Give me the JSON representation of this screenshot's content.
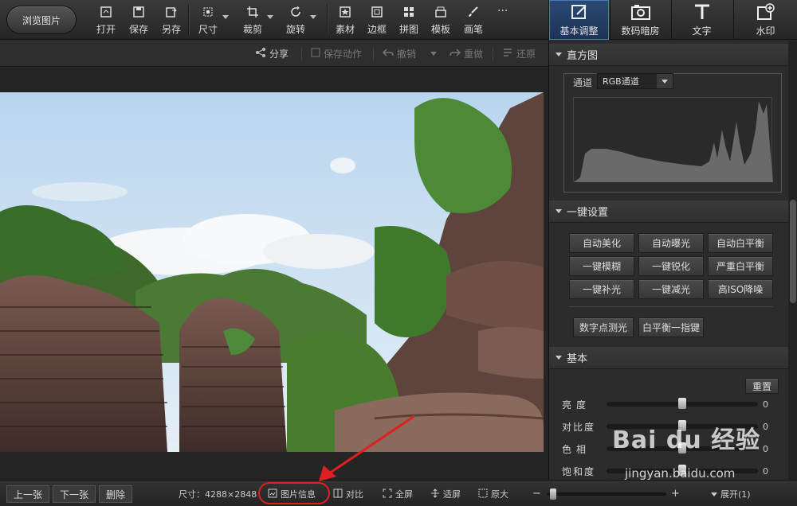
{
  "topbar": {
    "browse_label": "浏览图片",
    "tools": [
      {
        "label": "打开",
        "icon": "open-icon"
      },
      {
        "label": "保存",
        "icon": "save-icon"
      },
      {
        "label": "另存",
        "icon": "save-as-icon"
      },
      {
        "label": "尺寸",
        "icon": "resize-icon"
      },
      {
        "label": "裁剪",
        "icon": "crop-icon"
      },
      {
        "label": "旋转",
        "icon": "rotate-icon"
      },
      {
        "label": "素材",
        "icon": "material-icon"
      },
      {
        "label": "边框",
        "icon": "border-icon"
      },
      {
        "label": "拼图",
        "icon": "collage-icon"
      },
      {
        "label": "模板",
        "icon": "template-icon"
      },
      {
        "label": "画笔",
        "icon": "brush-icon"
      }
    ],
    "more_label": "···",
    "tabs": [
      {
        "label": "基本调整",
        "icon": "edit-icon",
        "active": true
      },
      {
        "label": "数码暗房",
        "icon": "camera-icon",
        "active": false
      },
      {
        "label": "文字",
        "icon": "text-icon",
        "active": false
      },
      {
        "label": "水印",
        "icon": "watermark-icon",
        "active": false
      }
    ]
  },
  "subbar": {
    "share": "分享",
    "save_action": "保存动作",
    "undo": "撤销",
    "redo": "重做",
    "restore": "还原"
  },
  "panel": {
    "histogram": {
      "title": "直方图",
      "channel_label": "通道",
      "channel_value": "RGB通道"
    },
    "one_click": {
      "title": "一键设置",
      "buttons": [
        "自动美化",
        "自动曝光",
        "自动白平衡",
        "一键模糊",
        "一键锐化",
        "严重白平衡",
        "一键补光",
        "一键减光",
        "高ISO降噪"
      ],
      "extra_buttons": [
        "数字点测光",
        "白平衡一指键"
      ]
    },
    "basic": {
      "title": "基本",
      "reset": "重置",
      "sliders": [
        {
          "label": "亮度",
          "value": "0",
          "level": 0.5
        },
        {
          "label": "对比度",
          "value": "0",
          "level": 0.5
        },
        {
          "label": "色相",
          "value": "0",
          "level": 0.5
        },
        {
          "label": "饱和度",
          "value": "0",
          "level": 0.5
        }
      ]
    }
  },
  "bottombar": {
    "prev": "上一张",
    "next": "下一张",
    "delete": "删除",
    "size_label": "尺寸：4288×2848",
    "info": "图片信息",
    "compare": "对比",
    "fullscreen": "全屏",
    "fit": "适屏",
    "original": "原大",
    "minus": "−",
    "plus": "+",
    "expand": "展开(1)"
  },
  "watermark": {
    "brand": "Bai du 经验",
    "url": "jingyan.baidu.com"
  },
  "colors": {
    "accent": "#2b4a73",
    "annotation": "#e02020"
  }
}
